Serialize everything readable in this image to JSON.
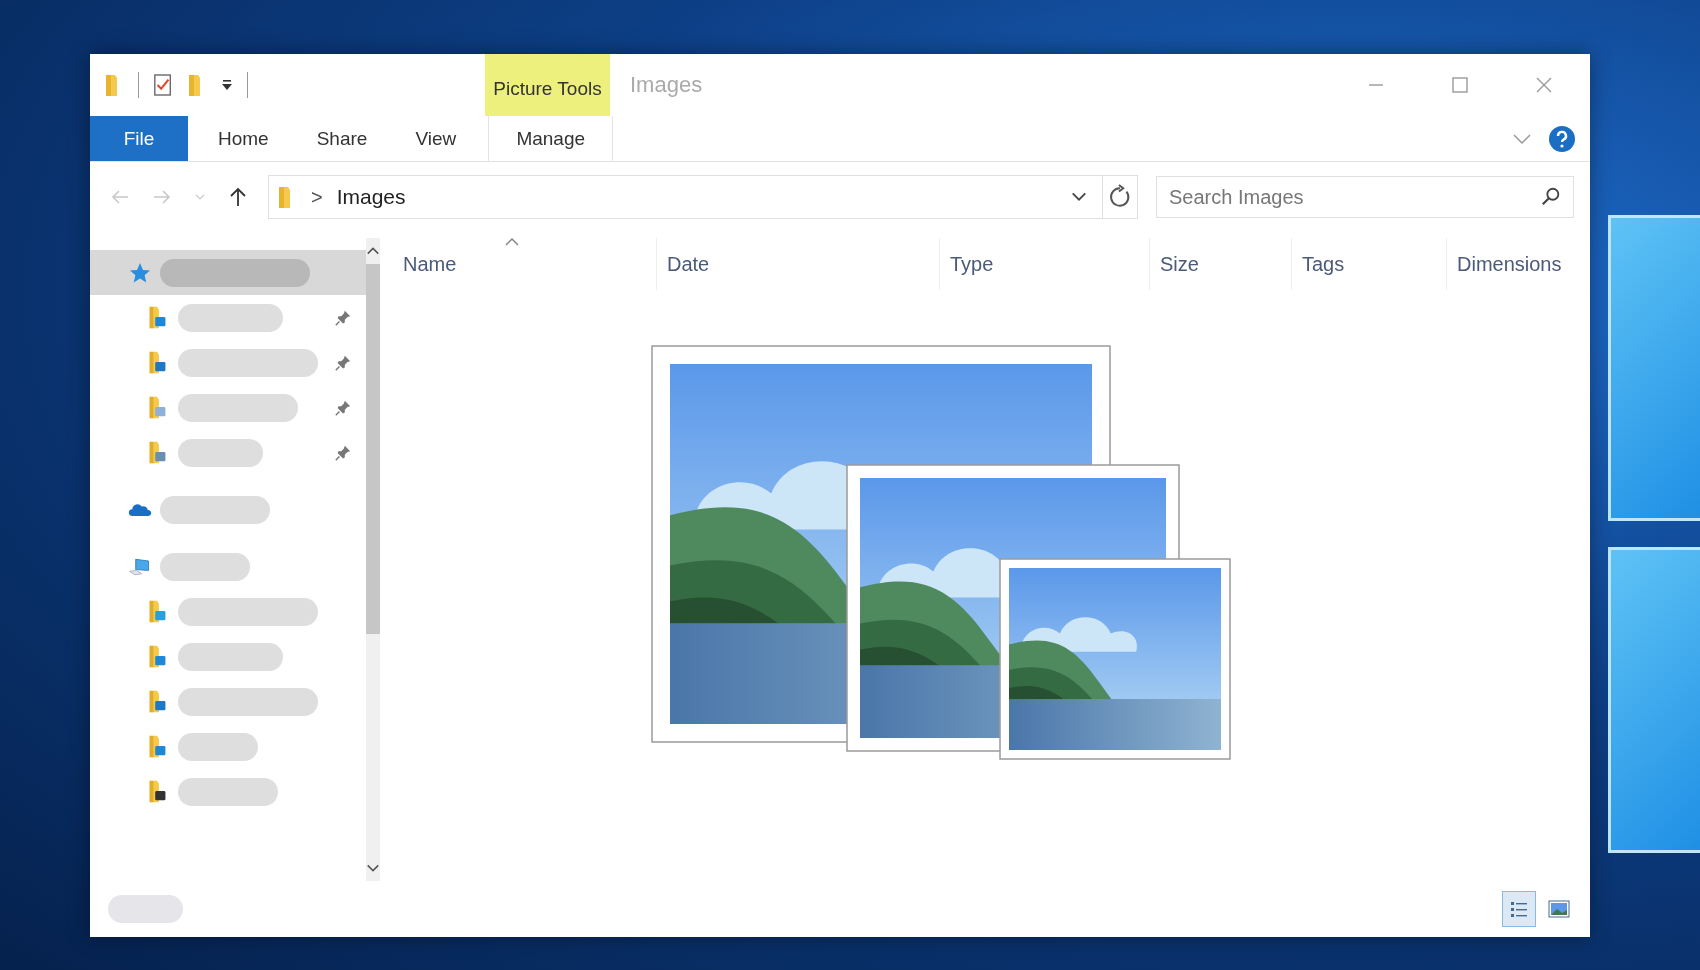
{
  "title_bar": {
    "context_tab": "Picture Tools",
    "title": "Images"
  },
  "ribbon_tabs": [
    {
      "label": "File",
      "kind": "file",
      "selected": false
    },
    {
      "label": "Home",
      "kind": "standard",
      "selected": false
    },
    {
      "label": "Share",
      "kind": "standard",
      "selected": false
    },
    {
      "label": "View",
      "kind": "standard",
      "selected": false
    },
    {
      "label": "Manage",
      "kind": "context",
      "selected": false
    }
  ],
  "nav_buttons": [
    {
      "kind": "back",
      "disabled": true
    },
    {
      "kind": "forward",
      "disabled": true
    },
    {
      "kind": "recent",
      "disabled": true
    },
    {
      "kind": "up",
      "disabled": false
    }
  ],
  "address_bar": {
    "separator": ">",
    "path": "Images"
  },
  "search": {
    "placeholder": "Search Images"
  },
  "navigation_pane": [
    {
      "kind": "star",
      "selected": true,
      "children": [
        {
          "kind": "desktop",
          "pinned": true,
          "selected": false
        },
        {
          "kind": "download",
          "pinned": true,
          "selected": false
        },
        {
          "kind": "document",
          "pinned": true,
          "selected": false
        },
        {
          "kind": "picture",
          "pinned": true,
          "selected": false
        }
      ]
    },
    {
      "kind": "cloud",
      "selected": false
    },
    {
      "kind": "computer",
      "selected": false,
      "children": [
        {
          "kind": "objects",
          "pinned": false,
          "selected": false
        },
        {
          "kind": "desktop",
          "pinned": false,
          "selected": false
        },
        {
          "kind": "download",
          "pinned": false,
          "selected": false
        },
        {
          "kind": "music",
          "pinned": false,
          "selected": false
        },
        {
          "kind": "video",
          "pinned": false,
          "selected": false
        }
      ]
    }
  ],
  "columns": [
    {
      "label": "Name",
      "sorted": true
    },
    {
      "label": "Date",
      "sorted": false
    },
    {
      "label": "Type",
      "sorted": false
    },
    {
      "label": "Size",
      "sorted": false
    },
    {
      "label": "Tags",
      "sorted": false
    },
    {
      "label": "Dimensions",
      "sorted": false
    }
  ],
  "view_buttons": [
    {
      "kind": "details",
      "selected": true
    },
    {
      "kind": "large-icons",
      "selected": false
    }
  ]
}
